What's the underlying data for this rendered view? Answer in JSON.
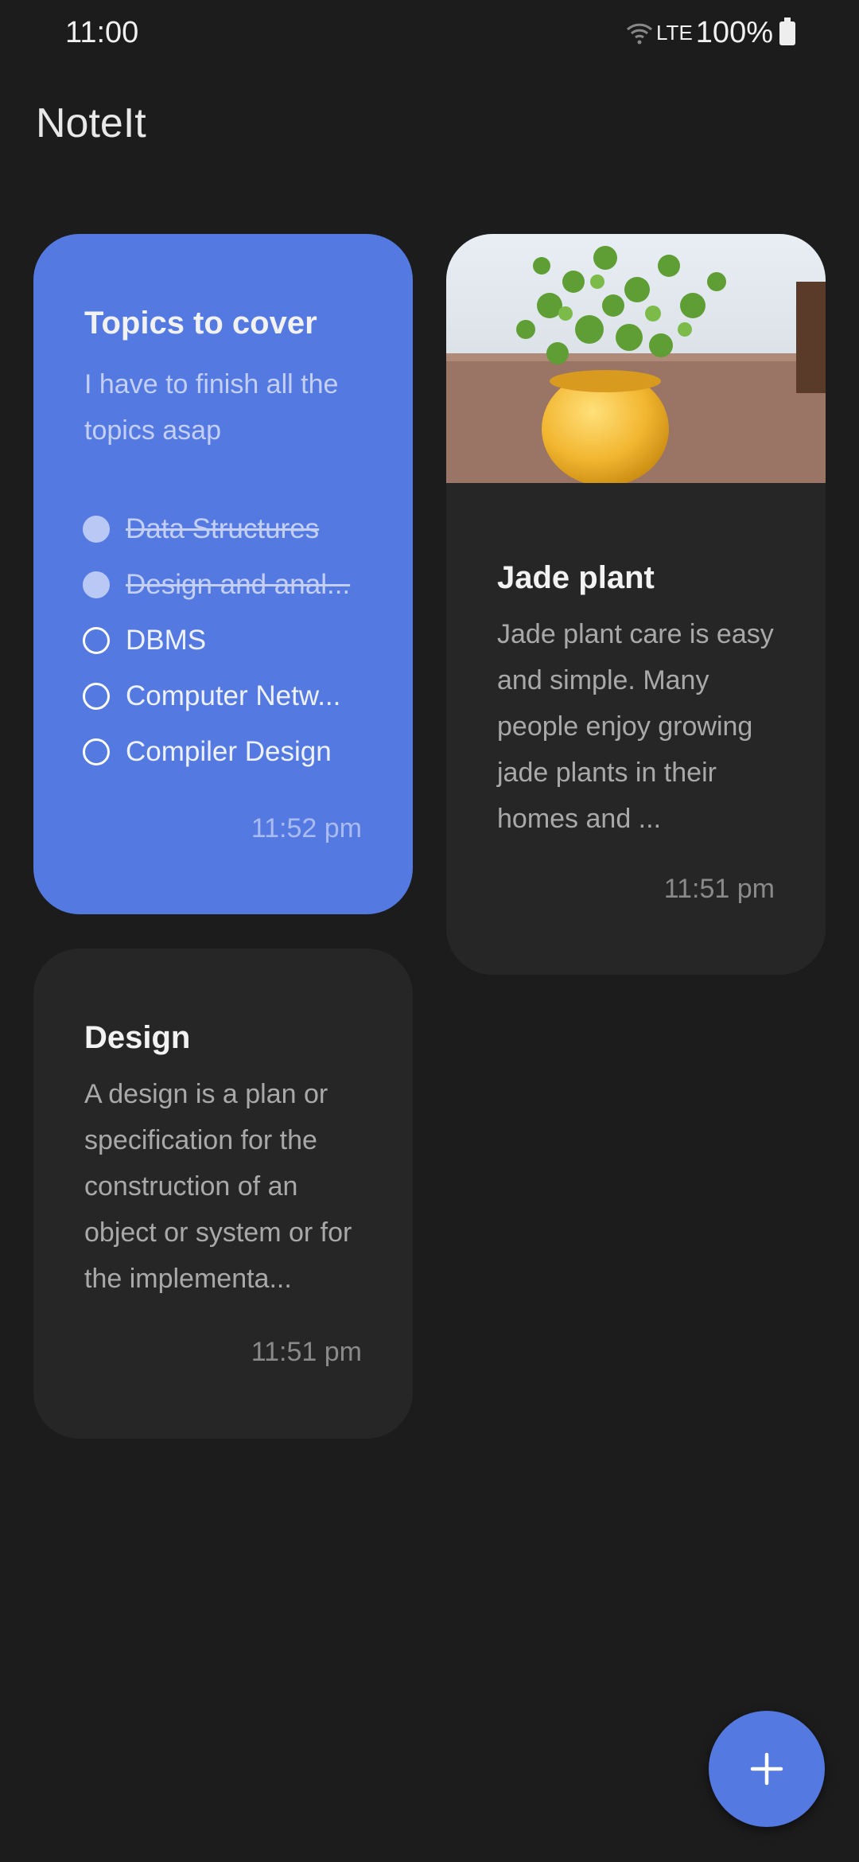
{
  "status_bar": {
    "time": "11:00",
    "network": "LTE",
    "battery": "100%",
    "icons": [
      "wifi-icon",
      "battery-icon"
    ]
  },
  "app": {
    "title": "NoteIt",
    "accent_color": "#5479e0"
  },
  "notes": [
    {
      "title": "Topics to cover",
      "body": "I have to finish all the topics asap",
      "checklist": [
        {
          "label": "Data Structures",
          "checked": true
        },
        {
          "label": "Design and anal...",
          "checked": true
        },
        {
          "label": "DBMS",
          "checked": false
        },
        {
          "label": "Computer Netw...",
          "checked": false
        },
        {
          "label": "Compiler Design",
          "checked": false
        }
      ],
      "time": "11:52 pm",
      "color": "#5479e0"
    },
    {
      "title": "Jade plant",
      "body": "Jade plant care is easy and simple. Many people enjoy growing jade plants in their homes and ...",
      "time": "11:51 pm",
      "image": "jade plant in yellow pot"
    },
    {
      "title": "Design",
      "body": "A design is a plan or specification for the construction of an object or system or for the implementa...",
      "time": "11:51 pm"
    }
  ],
  "fab": {
    "icon": "plus-icon"
  }
}
